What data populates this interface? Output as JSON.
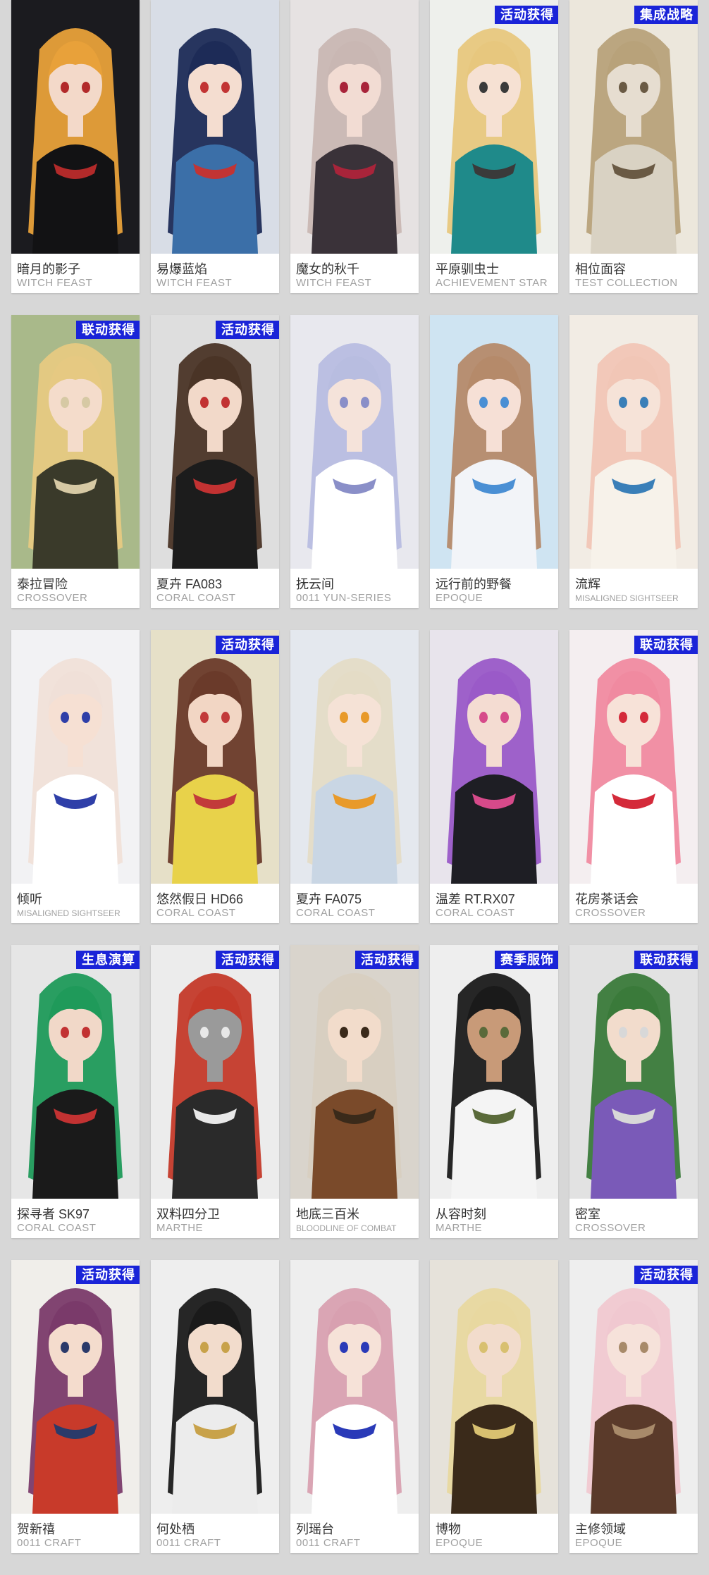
{
  "outfits": [
    {
      "name": "暗月的影子",
      "series": "WITCH FEAST",
      "badge": "",
      "palette": {
        "bg": "#1b1b1f",
        "hair": "#e8a13a",
        "outfit": "#121214",
        "accent": "#b22a2a",
        "skin": "#f3d9c9"
      }
    },
    {
      "name": "易爆蓝焰",
      "series": "WITCH FEAST",
      "badge": "",
      "palette": {
        "bg": "#d8dde6",
        "hair": "#1d2b57",
        "outfit": "#3b6fa8",
        "accent": "#c23434",
        "skin": "#f4ddd0"
      }
    },
    {
      "name": "魔女的秋千",
      "series": "WITCH FEAST",
      "badge": "",
      "palette": {
        "bg": "#e6e2e2",
        "hair": "#c9b7b3",
        "outfit": "#3a3239",
        "accent": "#a8243a",
        "skin": "#f2dcd3"
      }
    },
    {
      "name": "平原驯虫士",
      "series": "ACHIEVEMENT STAR",
      "badge": "活动获得",
      "palette": {
        "bg": "#eef0ec",
        "hair": "#e7c77e",
        "outfit": "#1f8a8a",
        "accent": "#3a3a3a",
        "skin": "#f6e1d3"
      }
    },
    {
      "name": "相位面容",
      "series": "TEST COLLECTION",
      "badge": "集成战略",
      "palette": {
        "bg": "#ece7dc",
        "hair": "#b8a27a",
        "outfit": "#d9d2c3",
        "accent": "#6a5a44",
        "skin": "#e6ddd0"
      }
    },
    {
      "name": "泰拉冒险",
      "series": "CROSSOVER",
      "badge": "联动获得",
      "palette": {
        "bg": "#a9b98a",
        "hair": "#e6c982",
        "outfit": "#3a3a2a",
        "accent": "#d6c9a4",
        "skin": "#f4dccb"
      }
    },
    {
      "name": "夏卉 FA083",
      "series": "CORAL COAST",
      "badge": "活动获得",
      "palette": {
        "bg": "#dedede",
        "hair": "#4a3426",
        "outfit": "#1c1c1c",
        "accent": "#c23232",
        "skin": "#f2d9c9"
      }
    },
    {
      "name": "抚云间",
      "series": "0011 YUN-SERIES",
      "badge": "",
      "palette": {
        "bg": "#e8e8ee",
        "hair": "#b8bde0",
        "outfit": "#ffffff",
        "accent": "#8a8fc8",
        "skin": "#f5e3da"
      }
    },
    {
      "name": "远行前的野餐",
      "series": "EPOQUE",
      "badge": "",
      "palette": {
        "bg": "#cfe4f2",
        "hair": "#b58a6a",
        "outfit": "#f2f4f8",
        "accent": "#4a8fd4",
        "skin": "#f6e0d6"
      }
    },
    {
      "name": "流辉",
      "series": "MISALIGNED SIGHTSEER",
      "badge": "",
      "palette": {
        "bg": "#f2ece4",
        "hair": "#f1c6b6",
        "outfit": "#f7f2ea",
        "accent": "#3a7fb8",
        "skin": "#f6e3d8"
      }
    },
    {
      "name": "倾听",
      "series": "MISALIGNED SIGHTSEER",
      "badge": "",
      "palette": {
        "bg": "#f2f2f4",
        "hair": "#f0e0d8",
        "outfit": "#ffffff",
        "accent": "#2f3fa8",
        "skin": "#f6e0d3"
      }
    },
    {
      "name": "悠然假日 HD66",
      "series": "CORAL COAST",
      "badge": "活动获得",
      "palette": {
        "bg": "#e6e0c8",
        "hair": "#6a3a2a",
        "outfit": "#e8d24a",
        "accent": "#c23a3a",
        "skin": "#f2d6c4"
      }
    },
    {
      "name": "夏卉 FA075",
      "series": "CORAL COAST",
      "badge": "",
      "palette": {
        "bg": "#e4e8ee",
        "hair": "#e4dcc6",
        "outfit": "#c9d6e4",
        "accent": "#e89a2a",
        "skin": "#f5e2d6"
      }
    },
    {
      "name": "温差 RT.RX07",
      "series": "CORAL COAST",
      "badge": "",
      "palette": {
        "bg": "#e8e4ec",
        "hair": "#9a5ac8",
        "outfit": "#1e1e24",
        "accent": "#d64a8a",
        "skin": "#f4dcd2"
      }
    },
    {
      "name": "花房茶话会",
      "series": "CROSSOVER",
      "badge": "联动获得",
      "palette": {
        "bg": "#f4eef0",
        "hair": "#f08aa0",
        "outfit": "#ffffff",
        "accent": "#d42a3a",
        "skin": "#f7e2d8"
      }
    },
    {
      "name": "探寻者 SK97",
      "series": "CORAL COAST",
      "badge": "生息演算",
      "palette": {
        "bg": "#e6e6e6",
        "hair": "#1f9a5a",
        "outfit": "#1a1a1a",
        "accent": "#c23232",
        "skin": "#f1d8c8"
      }
    },
    {
      "name": "双料四分卫",
      "series": "MARTHE",
      "badge": "活动获得",
      "palette": {
        "bg": "#ececec",
        "hair": "#c43a2a",
        "outfit": "#2a2a2a",
        "accent": "#e8e8e8",
        "skin": "#9a9a9a"
      }
    },
    {
      "name": "地底三百米",
      "series": "BLOODLINE OF COMBAT",
      "badge": "活动获得",
      "palette": {
        "bg": "#d9d4cc",
        "hair": "#d8cfc0",
        "outfit": "#7a4a2a",
        "accent": "#3a2a1a",
        "skin": "#f2dccb"
      }
    },
    {
      "name": "从容时刻",
      "series": "MARTHE",
      "badge": "赛季服饰",
      "palette": {
        "bg": "#eeeeee",
        "hair": "#1a1a1a",
        "outfit": "#f4f4f4",
        "accent": "#5a6a3a",
        "skin": "#c89a78"
      }
    },
    {
      "name": "密室",
      "series": "CROSSOVER",
      "badge": "联动获得",
      "palette": {
        "bg": "#e2e2e2",
        "hair": "#3a7a3a",
        "outfit": "#7a5ab8",
        "accent": "#d8d8d8",
        "skin": "#f2dccc"
      }
    },
    {
      "name": "贺新禧",
      "series": "0011 CRAFT",
      "badge": "活动获得",
      "palette": {
        "bg": "#f0eeea",
        "hair": "#7a3a6a",
        "outfit": "#c83a2a",
        "accent": "#2a3a6a",
        "skin": "#f4dccd"
      }
    },
    {
      "name": "何处栖",
      "series": "0011 CRAFT",
      "badge": "",
      "palette": {
        "bg": "#eeeeee",
        "hair": "#1a1a1a",
        "outfit": "#ececec",
        "accent": "#c8a24a",
        "skin": "#f2dccc"
      }
    },
    {
      "name": "列瑶台",
      "series": "0011 CRAFT",
      "badge": "",
      "palette": {
        "bg": "#eeeeee",
        "hair": "#d8a0b0",
        "outfit": "#ffffff",
        "accent": "#2a3ab8",
        "skin": "#f6e2d8"
      }
    },
    {
      "name": "博物",
      "series": "EPOQUE",
      "badge": "",
      "palette": {
        "bg": "#e6e2da",
        "hair": "#e8d8a0",
        "outfit": "#3a2a1a",
        "accent": "#d8c070",
        "skin": "#f2dccc"
      }
    },
    {
      "name": "主修领域",
      "series": "EPOQUE",
      "badge": "活动获得",
      "palette": {
        "bg": "#eeeeee",
        "hair": "#f0c8d0",
        "outfit": "#5a3a2a",
        "accent": "#a88a6a",
        "skin": "#f6e2da"
      }
    }
  ]
}
